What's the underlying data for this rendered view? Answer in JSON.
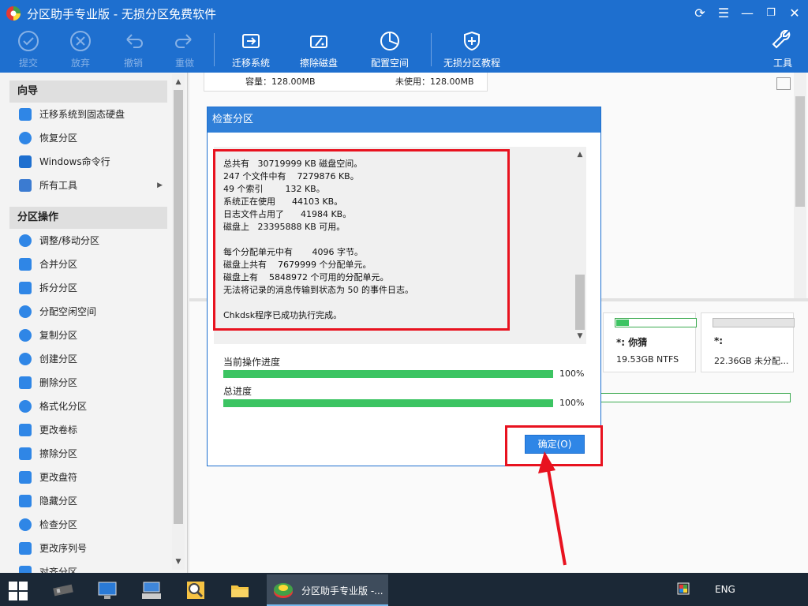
{
  "window": {
    "title": "分区助手专业版 - 无损分区免费软件"
  },
  "toolbar": {
    "submit": "提交",
    "discard": "放弃",
    "undo": "撤销",
    "redo": "重做",
    "migrate": "迁移系统",
    "wipe_disk": "擦除磁盘",
    "allocate": "配置空间",
    "tutorial": "无损分区教程",
    "tools": "工具"
  },
  "sidebar": {
    "wizard_title": "向导",
    "wizard_items": [
      "迁移系统到固态硬盘",
      "恢复分区",
      "Windows命令行",
      "所有工具"
    ],
    "ops_title": "分区操作",
    "ops_items": [
      "调整/移动分区",
      "合并分区",
      "拆分分区",
      "分配空闲空间",
      "复制分区",
      "创建分区",
      "删除分区",
      "格式化分区",
      "更改卷标",
      "擦除分区",
      "更改盘符",
      "隐藏分区",
      "检查分区",
      "更改序列号",
      "对齐分区"
    ]
  },
  "disk_summary": {
    "capacity": "容量：128.00MB",
    "unused": "未使用：128.00MB"
  },
  "partitions": [
    {
      "name": "*: 你猜",
      "info": "19.53GB NTFS",
      "used_fraction": 0.16
    },
    {
      "name": "*:",
      "info": "22.36GB 未分配...",
      "used_fraction": 0
    }
  ],
  "dialog": {
    "title": "检查分区",
    "log_lines": [
      "总共有   30719999 KB 磁盘空间。",
      "247 个文件中有    7279876 KB。",
      "49 个索引        132 KB。",
      "系统正在使用      44103 KB。",
      "日志文件占用了      41984 KB。",
      "磁盘上   23395888 KB 可用。",
      "",
      "每个分配单元中有       4096 字节。",
      "磁盘上共有    7679999 个分配单元。",
      "磁盘上有    5848972 个可用的分配单元。",
      "无法将记录的消息传输到状态为 50 的事件日志。",
      "",
      "Chkdsk程序已成功执行完成。"
    ],
    "current_progress_label": "当前操作进度",
    "current_progress": 100,
    "current_progress_text": "100%",
    "total_progress_label": "总进度",
    "total_progress": 100,
    "total_progress_text": "100%",
    "ok_button": "确定(O)"
  },
  "taskbar": {
    "active_app_label": "分区助手专业版 -...",
    "language": "ENG"
  },
  "colors": {
    "titlebar": "#1e6fcf",
    "progress": "#3cc462",
    "highlight": "#e8121f"
  }
}
